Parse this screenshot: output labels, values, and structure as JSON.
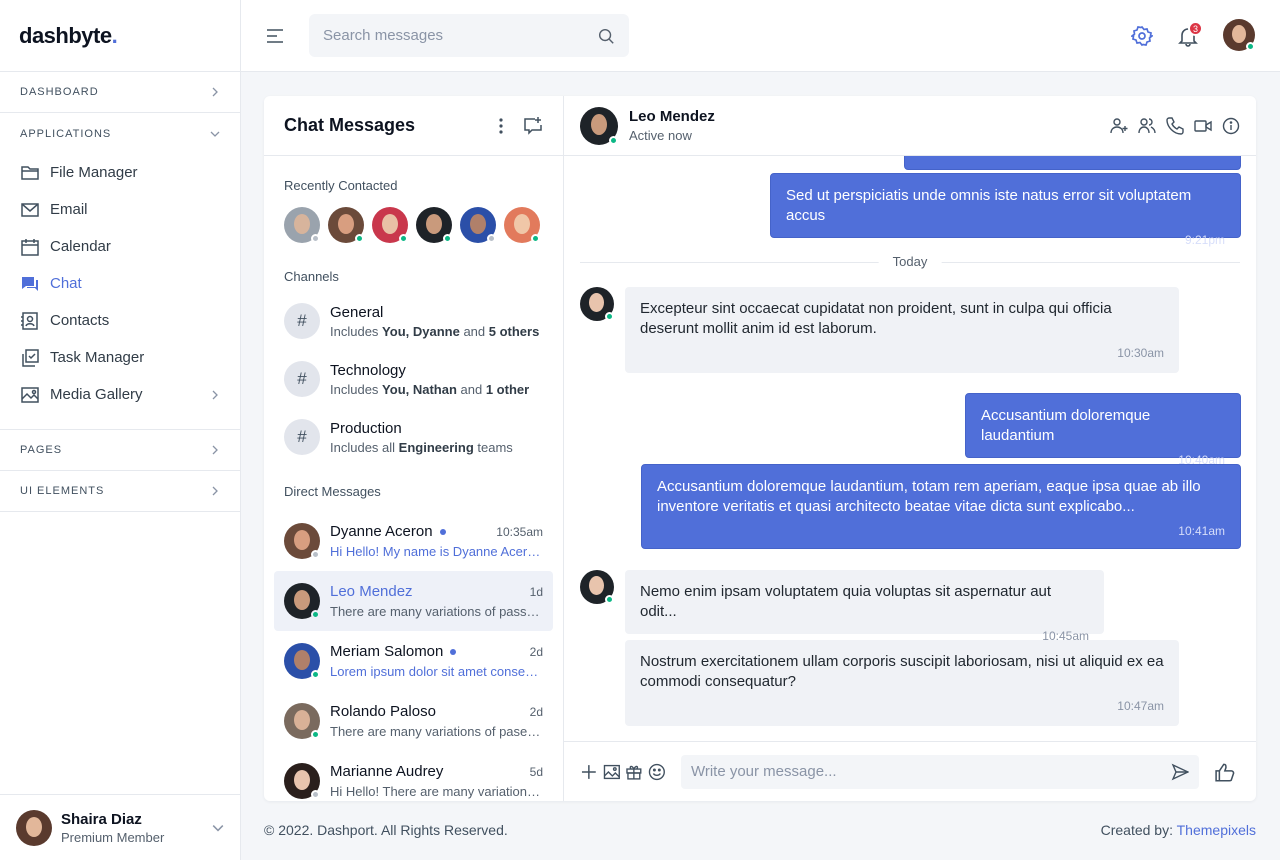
{
  "brand": {
    "name": "dashbyte",
    "dot": "."
  },
  "sidebar": {
    "sections": {
      "dashboard": "DASHBOARD",
      "applications": "APPLICATIONS",
      "pages": "PAGES",
      "ui_elements": "UI ELEMENTS"
    },
    "items": [
      {
        "label": "File Manager",
        "icon": "folder-icon"
      },
      {
        "label": "Email",
        "icon": "envelope-icon"
      },
      {
        "label": "Calendar",
        "icon": "calendar-icon"
      },
      {
        "label": "Chat",
        "icon": "chat-icon",
        "active": true
      },
      {
        "label": "Contacts",
        "icon": "contacts-icon"
      },
      {
        "label": "Task Manager",
        "icon": "tasks-icon"
      },
      {
        "label": "Media Gallery",
        "icon": "gallery-icon"
      }
    ],
    "user": {
      "name": "Shaira Diaz",
      "role": "Premium Member"
    }
  },
  "header": {
    "search_placeholder": "Search messages",
    "notifications": "3"
  },
  "chat_list": {
    "title": "Chat Messages",
    "recent_label": "Recently Contacted",
    "channels_label": "Channels",
    "channels": [
      {
        "name": "General",
        "pre": "Includes ",
        "b1": "You, Dyanne",
        "mid": " and ",
        "b2": "5 others"
      },
      {
        "name": "Technology",
        "pre": "Includes ",
        "b1": "You, Nathan",
        "mid": " and ",
        "b2": "1 other"
      },
      {
        "name": "Production",
        "pre": "Includes all ",
        "b1": "Engineering",
        "mid": " teams",
        "b2": ""
      }
    ],
    "dm_label": "Direct Messages",
    "dms": [
      {
        "name": "Dyanne Aceron",
        "time": "10:35am",
        "msg": "Hi Hello! My name is Dyanne Aceron and I am",
        "unread": true
      },
      {
        "name": "Leo Mendez",
        "time": "1d",
        "msg": "There are many variations of pass. Everyone",
        "unread": false
      },
      {
        "name": "Meriam Salomon",
        "time": "2d",
        "msg": "Lorem ipsum dolor sit amet consectetur adip",
        "unread": true
      },
      {
        "name": "Rolando Paloso",
        "time": "2d",
        "msg": "There are many variations of paserrage",
        "unread": false
      },
      {
        "name": "Marianne Audrey",
        "time": "5d",
        "msg": "Hi Hello! There are many variations in",
        "unread": false
      }
    ]
  },
  "conversation": {
    "name": "Leo Mendez",
    "status": "Active now",
    "divider": "Today",
    "messages": [
      {
        "text": "Sed ut perspiciatis unde omnis iste natus error sit voluptatem accus",
        "time": "9:21pm",
        "me": true
      },
      {
        "text": "Excepteur sint occaecat cupidatat non proident, sunt in culpa qui officia deserunt mollit anim id est laborum.",
        "time": "10:30am",
        "me": false
      },
      {
        "text": "Accusantium doloremque laudantium",
        "time": "10:40am",
        "me": true
      },
      {
        "text": "Accusantium doloremque laudantium, totam rem aperiam, eaque ipsa quae ab illo inventore veritatis et quasi architecto beatae vitae dicta sunt explicabo...",
        "time": "10:41am",
        "me": true
      },
      {
        "text": "Nemo enim ipsam voluptatem quia voluptas sit aspernatur aut odit...",
        "time": "10:45am",
        "me": false
      },
      {
        "text": "Nostrum exercitationem ullam corporis suscipit laboriosam, nisi ut aliquid ex ea commodi consequatur?",
        "time": "10:47am",
        "me": false
      }
    ],
    "compose_placeholder": "Write your message..."
  },
  "footer": {
    "copyright": "© 2022. Dashport. All Rights Reserved.",
    "created_by": "Created by: ",
    "creator": "Themepixels"
  },
  "colors": {
    "accent": "#506fd9",
    "online": "#0cb785"
  }
}
